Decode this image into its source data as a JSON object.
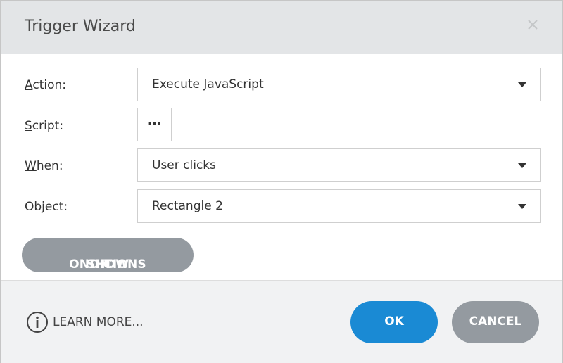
{
  "dialog": {
    "title": "Trigger Wizard"
  },
  "fields": {
    "action": {
      "label_ul": "A",
      "label_rest": "ction:",
      "value": "Execute JavaScript"
    },
    "script": {
      "label_ul": "S",
      "label_rest": "cript:",
      "button_label": "..."
    },
    "when": {
      "label_ul": "W",
      "label_rest": "hen:",
      "value": "User clicks"
    },
    "object": {
      "label": "Object:",
      "value": "Rectangle 2"
    }
  },
  "show_conditions": {
    "pre": "SHOW ",
    "ul": "C",
    "post": "ONDITIONS"
  },
  "footer": {
    "learn_more": "LEARN MORE...",
    "ok_label": "OK",
    "cancel_label": "CANCEL"
  },
  "icons": {
    "close": "close-icon",
    "info": "info-icon",
    "dropdown": "chevron-down-icon"
  },
  "colors": {
    "header_bg": "#e3e5e7",
    "primary": "#1a8ad4",
    "secondary": "#949aa0",
    "footer_bg": "#f1f2f3"
  }
}
